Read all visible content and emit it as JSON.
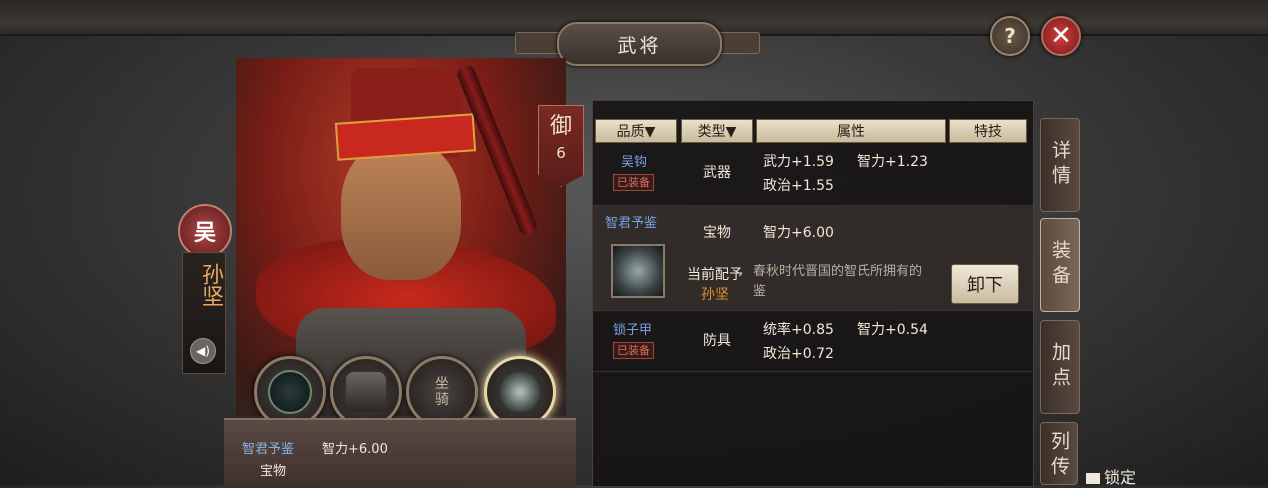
{
  "window": {
    "title": "武将",
    "help_label": "?",
    "close_label": "✕"
  },
  "hero": {
    "kingdom": "吴",
    "name": "孙坚",
    "banner_char": "御",
    "banner_level": "6"
  },
  "slots": [
    {
      "name": "weapon",
      "icon": "whip-icon",
      "label": ""
    },
    {
      "name": "armor",
      "icon": "armor-icon",
      "label": ""
    },
    {
      "name": "mount",
      "icon": "mount-icon",
      "label": "坐骑"
    },
    {
      "name": "treasure",
      "icon": "cauldron-icon",
      "label": ""
    }
  ],
  "tooltip": {
    "name": "智君予鉴",
    "stat": "智力+6.00",
    "type": "宝物"
  },
  "table": {
    "headers": {
      "quality": "品质▼",
      "type": "类型▼",
      "attr": "属性",
      "skill": "特技"
    },
    "rows": [
      {
        "name": "吴钩",
        "badge": "已装备",
        "type": "武器",
        "attr1": "武力+1.59",
        "attr2": "智力+1.23",
        "attr3": "政治+1.55"
      },
      {
        "name": "智君予鉴",
        "type": "宝物",
        "attr1": "智力+6.00",
        "assigned_label": "当前配予",
        "assigned_to": "孙坚",
        "desc": "春秋时代晋国的智氏所拥有的鉴",
        "button": "卸下"
      },
      {
        "name": "锁子甲",
        "badge": "已装备",
        "type": "防具",
        "attr1": "统率+0.85",
        "attr2": "智力+0.54",
        "attr3": "政治+0.72"
      }
    ]
  },
  "side_tabs": [
    "详情",
    "装备",
    "加点",
    "列传"
  ],
  "lock_label": "锁定",
  "colors": {
    "accent_red": "#c8281e",
    "item_blue": "#7aa0e0",
    "hero_orange": "#e8a860"
  }
}
